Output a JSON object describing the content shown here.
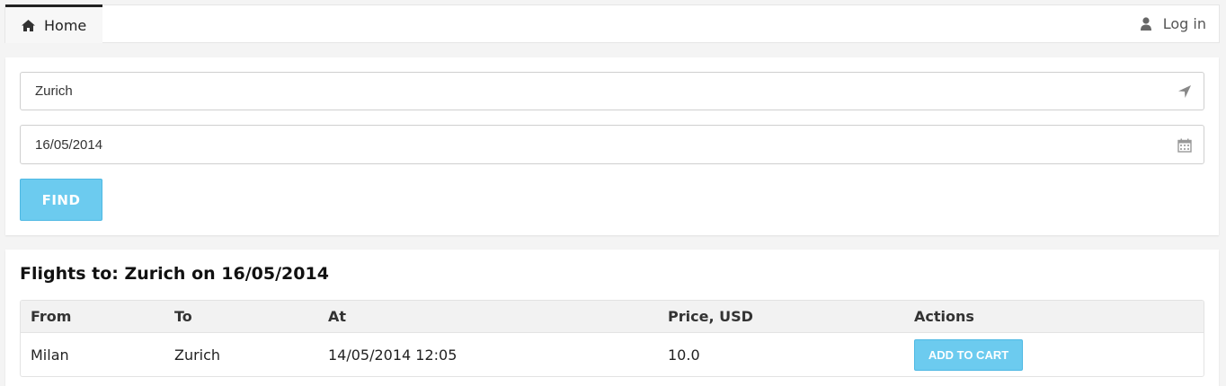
{
  "nav": {
    "home_label": "Home",
    "home_icon": "home-icon",
    "login_label": "Log in",
    "login_icon": "user-icon"
  },
  "search": {
    "destination_value": "Zurich",
    "destination_icon": "location-arrow-icon",
    "date_value": "16/05/2014",
    "date_icon": "calendar-icon",
    "find_label": "FIND"
  },
  "results": {
    "title": "Flights to: Zurich on 16/05/2014",
    "columns": [
      "From",
      "To",
      "At",
      "Price, USD",
      "Actions"
    ],
    "rows": [
      {
        "from": "Milan",
        "to": "Zurich",
        "at": "14/05/2014 12:05",
        "price": "10.0",
        "action_label": "ADD TO CART"
      }
    ]
  },
  "colors": {
    "accent": "#6ccbef",
    "accent_border": "#4db8e3",
    "page_bg": "#f4f4f4",
    "table_header_bg": "#f2f2f2"
  }
}
